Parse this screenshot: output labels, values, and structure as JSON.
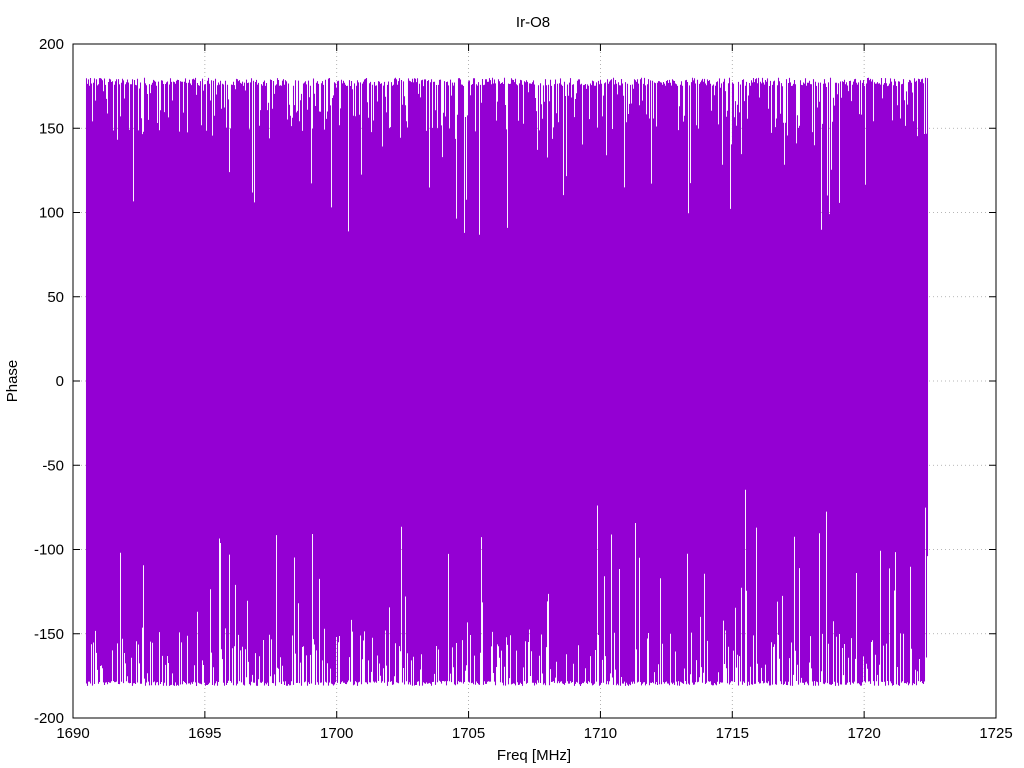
{
  "chart_data": {
    "type": "line",
    "title": "Ir-O8",
    "xlabel": "Freq [MHz]",
    "ylabel": "Phase",
    "xlim": [
      1690,
      1725
    ],
    "ylim": [
      -200,
      200
    ],
    "xticks": [
      1690,
      1695,
      1700,
      1705,
      1710,
      1715,
      1720,
      1725
    ],
    "yticks": [
      -200,
      -150,
      -100,
      -50,
      0,
      50,
      100,
      150,
      200
    ],
    "xtick_labels": [
      "1690",
      "1695",
      "1700",
      "1705",
      "1710",
      "1715",
      "1720",
      "1725"
    ],
    "ytick_labels": [
      "-200",
      "-150",
      "-100",
      "-50",
      "0",
      "50",
      "100",
      "150",
      "200"
    ],
    "grid": true,
    "legend": "none",
    "series": [
      {
        "color": "#9400d3",
        "x_range": [
          1690.5,
          1722.4
        ],
        "y_range": [
          -180,
          180
        ],
        "max_envelope_typical": 175,
        "min_envelope_typical": -178,
        "notable_points": [
          {
            "x": 1700.2,
            "y": 56
          },
          {
            "x": 1706.9,
            "y": 55
          },
          {
            "x": 1720.0,
            "y": 29
          },
          {
            "x": 1697.3,
            "y": 85
          },
          {
            "x": 1716.2,
            "y": -51
          },
          {
            "x": 1695.7,
            "y": -61
          },
          {
            "x": 1692.0,
            "y": -65
          }
        ]
      }
    ]
  }
}
